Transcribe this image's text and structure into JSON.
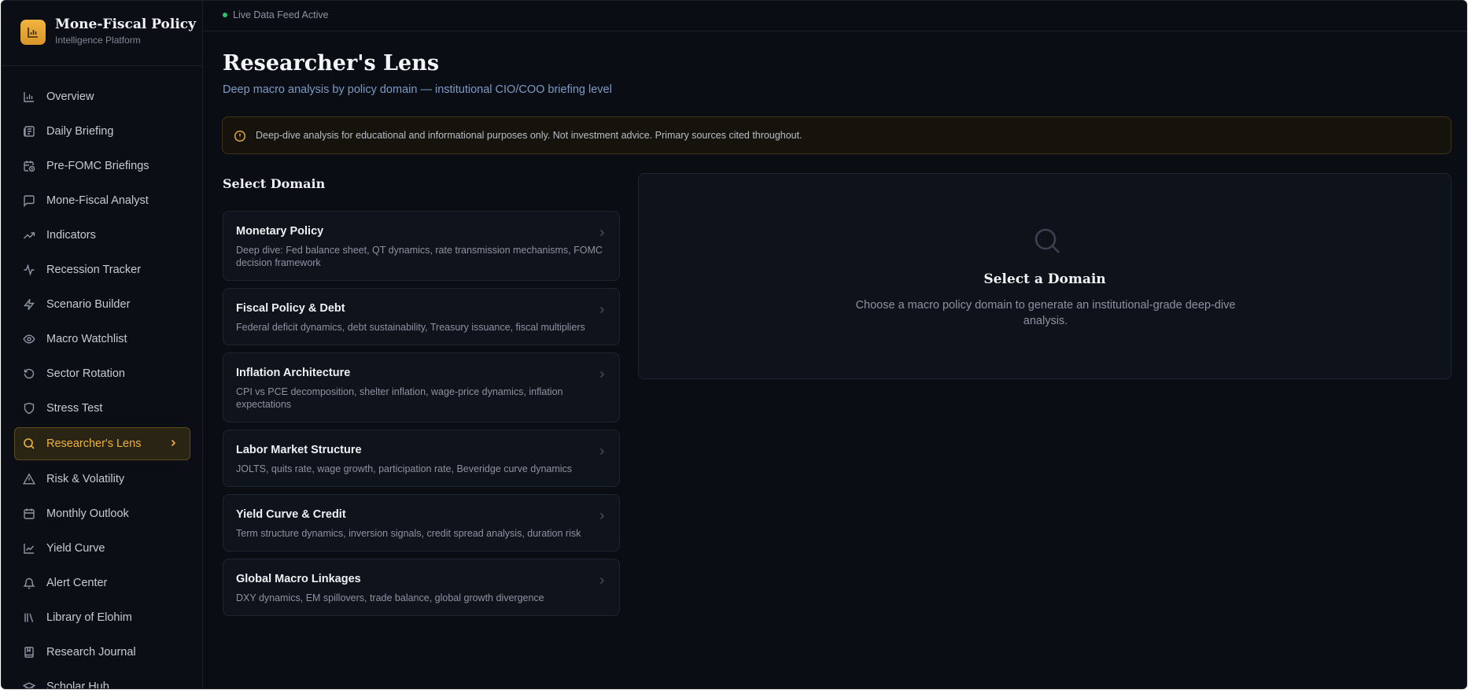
{
  "brand": {
    "title": "Mone-Fiscal Policy",
    "subtitle": "Intelligence Platform",
    "logo_icon": "bar-chart-icon",
    "accent": "#f0b23d"
  },
  "topbar": {
    "status_text": "Live Data Feed Active",
    "status_color": "#2fbf71"
  },
  "sidebar": {
    "items": [
      {
        "label": "Overview",
        "icon": "bar-chart-icon"
      },
      {
        "label": "Daily Briefing",
        "icon": "newspaper-icon"
      },
      {
        "label": "Pre-FOMC Briefings",
        "icon": "calendar-clock-icon"
      },
      {
        "label": "Mone-Fiscal Analyst",
        "icon": "message-square-icon"
      },
      {
        "label": "Indicators",
        "icon": "trending-up-icon"
      },
      {
        "label": "Recession Tracker",
        "icon": "activity-icon"
      },
      {
        "label": "Scenario Builder",
        "icon": "zap-icon"
      },
      {
        "label": "Macro Watchlist",
        "icon": "eye-icon"
      },
      {
        "label": "Sector Rotation",
        "icon": "rotate-icon"
      },
      {
        "label": "Stress Test",
        "icon": "shield-icon"
      },
      {
        "label": "Researcher's Lens",
        "icon": "search-icon",
        "active": true
      },
      {
        "label": "Risk & Volatility",
        "icon": "warning-icon"
      },
      {
        "label": "Monthly Outlook",
        "icon": "calendar-icon"
      },
      {
        "label": "Yield Curve",
        "icon": "line-chart-icon"
      },
      {
        "label": "Alert Center",
        "icon": "bell-icon"
      },
      {
        "label": "Library of Elohim",
        "icon": "library-icon"
      },
      {
        "label": "Research Journal",
        "icon": "book-icon"
      },
      {
        "label": "Scholar Hub",
        "icon": "graduation-cap-icon"
      }
    ]
  },
  "main": {
    "title": "Researcher's Lens",
    "subtitle": "Deep macro analysis by policy domain — institutional CIO/COO briefing level",
    "notice": "Deep-dive analysis for educational and informational purposes only. Not investment advice. Primary sources cited throughout.",
    "section_title": "Select Domain",
    "domains": [
      {
        "name": "Monetary Policy",
        "desc": "Deep dive: Fed balance sheet, QT dynamics, rate transmission mechanisms, FOMC decision framework"
      },
      {
        "name": "Fiscal Policy & Debt",
        "desc": "Federal deficit dynamics, debt sustainability, Treasury issuance, fiscal multipliers"
      },
      {
        "name": "Inflation Architecture",
        "desc": "CPI vs PCE decomposition, shelter inflation, wage-price dynamics, inflation expectations"
      },
      {
        "name": "Labor Market Structure",
        "desc": "JOLTS, quits rate, wage growth, participation rate, Beveridge curve dynamics"
      },
      {
        "name": "Yield Curve & Credit",
        "desc": "Term structure dynamics, inversion signals, credit spread analysis, duration risk"
      },
      {
        "name": "Global Macro Linkages",
        "desc": "DXY dynamics, EM spillovers, trade balance, global growth divergence"
      }
    ],
    "detail": {
      "icon": "search-icon",
      "title": "Select a Domain",
      "desc": "Choose a macro policy domain to generate an institutional-grade deep-dive analysis."
    }
  }
}
